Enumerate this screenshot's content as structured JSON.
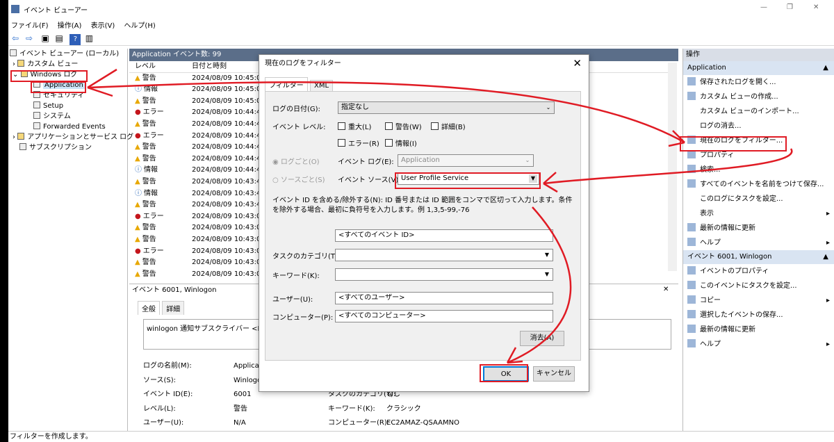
{
  "window": {
    "title": "イベント ビューアー",
    "minimize": "—",
    "restore": "❐",
    "close": "✕"
  },
  "menu": [
    "ファイル(F)",
    "操作(A)",
    "表示(V)",
    "ヘルプ(H)"
  ],
  "tree": {
    "root": "イベント ビューアー (ローカル)",
    "custom_views": "カスタム ビュー",
    "windows_logs": "Windows ログ",
    "application": "Application",
    "security": "セキュリティ",
    "setup": "Setup",
    "system": "システム",
    "forwarded": "Forwarded Events",
    "app_services": "アプリケーションとサービス ログ",
    "subscriptions": "サブスクリプション"
  },
  "center": {
    "header": "Application   イベント数: 99",
    "col_level": "レベル",
    "col_datetime": "日付と時刻",
    "rows": [
      {
        "level": "警告",
        "icon": "warning",
        "dt": "2024/08/09 10:45:02"
      },
      {
        "level": "情報",
        "icon": "info",
        "dt": "2024/08/09 10:45:02"
      },
      {
        "level": "警告",
        "icon": "warning",
        "dt": "2024/08/09 10:45:02"
      },
      {
        "level": "エラー",
        "icon": "error",
        "dt": "2024/08/09 10:44:41"
      },
      {
        "level": "警告",
        "icon": "warning",
        "dt": "2024/08/09 10:44:41"
      },
      {
        "level": "エラー",
        "icon": "error",
        "dt": "2024/08/09 10:44:41"
      },
      {
        "level": "警告",
        "icon": "warning",
        "dt": "2024/08/09 10:44:41"
      },
      {
        "level": "警告",
        "icon": "warning",
        "dt": "2024/08/09 10:44:41"
      },
      {
        "level": "情報",
        "icon": "info",
        "dt": "2024/08/09 10:44:40"
      },
      {
        "level": "警告",
        "icon": "warning",
        "dt": "2024/08/09 10:43:49"
      },
      {
        "level": "情報",
        "icon": "info",
        "dt": "2024/08/09 10:43:49"
      },
      {
        "level": "警告",
        "icon": "warning",
        "dt": "2024/08/09 10:43:49"
      },
      {
        "level": "エラー",
        "icon": "error",
        "dt": "2024/08/09 10:43:08"
      },
      {
        "level": "警告",
        "icon": "warning",
        "dt": "2024/08/09 10:43:08"
      },
      {
        "level": "警告",
        "icon": "warning",
        "dt": "2024/08/09 10:43:08"
      },
      {
        "level": "エラー",
        "icon": "error",
        "dt": "2024/08/09 10:43:08"
      },
      {
        "level": "警告",
        "icon": "warning",
        "dt": "2024/08/09 10:43:08"
      },
      {
        "level": "警告",
        "icon": "warning",
        "dt": "2024/08/09 10:43:08"
      }
    ],
    "detail_header": "イベント 6001, Winlogon",
    "detail_tab_general": "全般",
    "detail_tab_details": "詳細",
    "detail_message": "winlogon 通知サブスクライバー <Profil",
    "log_name_label": "ログの名前(M):",
    "log_name_value": "Applicat",
    "source_label": "ソース(S):",
    "source_value": "Winlogo",
    "event_id_label": "イベント ID(E):",
    "event_id_value": "6001",
    "level_label": "レベル(L):",
    "level_value": "警告",
    "user_label": "ユーザー(U):",
    "user_value": "N/A",
    "task_cat_label": "タスクのカテゴリ(Y):",
    "task_cat_value": "なし",
    "keyword_label": "キーワード(K):",
    "keyword_value": "クラシック",
    "computer_label": "コンピューター(R):",
    "computer_value": "EC2AMAZ-QSAAMNO"
  },
  "actions": {
    "header": "操作",
    "section1": "Application",
    "items1": [
      "保存されたログを開く...",
      "カスタム ビューの作成...",
      "カスタム ビューのインポート...",
      "ログの消去...",
      "現在のログをフィルター...",
      "プロパティ",
      "検索...",
      "すべてのイベントを名前をつけて保存...",
      "このログにタスクを設定...",
      "表示",
      "最新の情報に更新",
      "ヘルプ"
    ],
    "section2": "イベント 6001, Winlogon",
    "items2": [
      "イベントのプロパティ",
      "このイベントにタスクを設定...",
      "コピー",
      "選択したイベントの保存...",
      "最新の情報に更新",
      "ヘルプ"
    ]
  },
  "dialog": {
    "title": "現在のログをフィルター",
    "tab_filter": "フィルター",
    "tab_xml": "XML",
    "logged_label": "ログの日付(G):",
    "logged_value": "指定なし",
    "level_label": "イベント レベル:",
    "critical": "重大(L)",
    "warning": "警告(W)",
    "verbose": "詳細(B)",
    "error": "エラー(R)",
    "info": "情報(I)",
    "by_log": "ログごと(O)",
    "by_source": "ソースごと(S)",
    "event_log_label": "イベント ログ(E):",
    "event_log_value": "Application",
    "event_source_label": "イベント ソース(V):",
    "event_source_value": "User Profile Service",
    "id_help": "イベント ID を含める/除外する(N): ID 番号または ID 範囲をコンマで区切って入力します。条件を除外する場合、最初に負符号を入力します。例 1,3,5-99,-76",
    "event_ids": "<すべてのイベント ID>",
    "task_cat_label": "タスクのカテゴリ(T):",
    "keywords_label": "キーワード(K):",
    "user_label": "ユーザー(U):",
    "user_value": "<すべてのユーザー>",
    "computer_label": "コンピューター(P):",
    "computer_value": "<すべてのコンピューター>",
    "clear": "消去(A)",
    "ok": "OK",
    "cancel": "キャンセル"
  },
  "status": "フィルターを作成します。",
  "colors": {
    "accent_red": "#e01b24",
    "selected": "#0078d7",
    "header_bg": "#d9dee7"
  }
}
